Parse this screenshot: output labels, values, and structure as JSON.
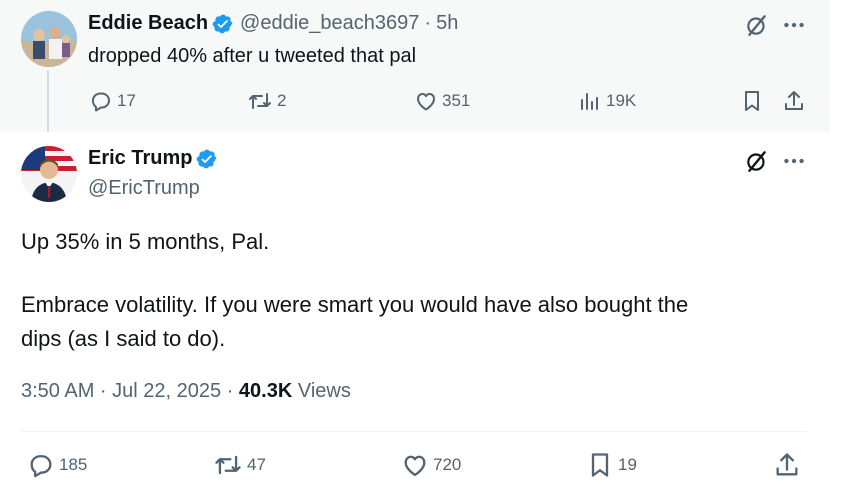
{
  "reply": {
    "author_name": "Eddie Beach",
    "handle": "@eddie_beach3697",
    "dot": "·",
    "time": "5h",
    "text": "dropped 40% after u tweeted that pal",
    "actions": {
      "replies": "17",
      "reposts": "2",
      "likes": "351",
      "views": "19K"
    }
  },
  "tweet": {
    "author_name": "Eric Trump",
    "handle": "@EricTrump",
    "line1": "Up 35% in 5 months, Pal.",
    "line2": "Embrace volatility. If you were smart you would have also bought the",
    "line3": "dips (as I said to do).",
    "timestamp": "3:50 AM · Jul 22, 2025 · ",
    "views_count": "40.3K",
    "views_label": " Views",
    "actions": {
      "replies": "185",
      "reposts": "47",
      "likes": "720",
      "bookmarks": "19"
    }
  },
  "colors": {
    "verified": "#1d9bf0",
    "muted": "#536471",
    "text": "#0f1419",
    "reply_bg": "#f7f9f9"
  },
  "icons": [
    "verified-badge-icon",
    "grok-icon",
    "more-icon",
    "reply-icon",
    "repost-icon",
    "like-icon",
    "views-icon",
    "bookmark-icon",
    "share-icon"
  ]
}
